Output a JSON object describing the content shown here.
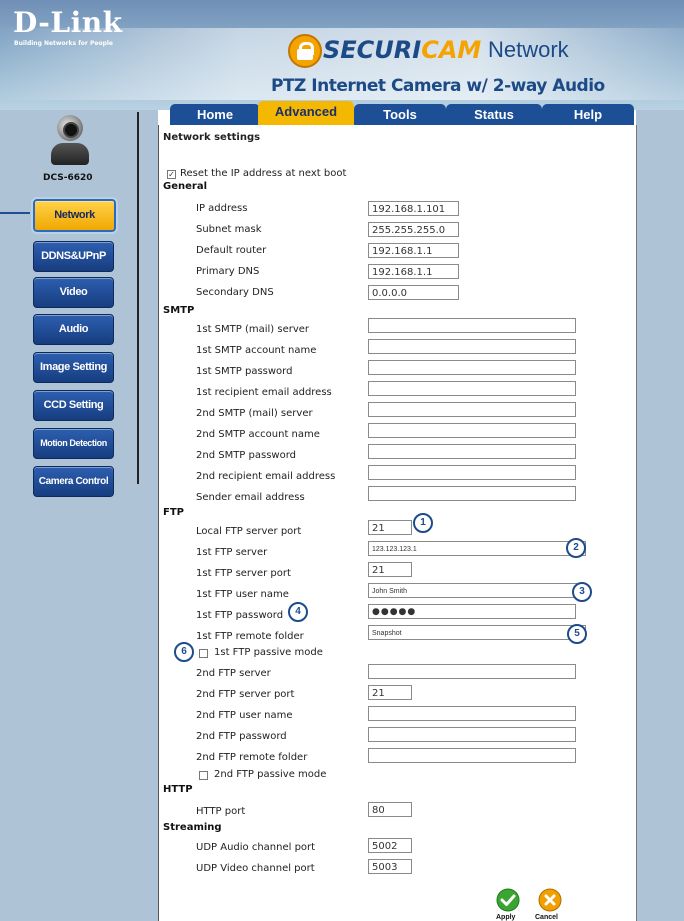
{
  "header": {
    "brand": "D-Link",
    "tagline": "Building Networks for People",
    "product_secu": "SECURI",
    "product_cam": "CAM",
    "product_network": "Network",
    "product_subtitle": "PTZ Internet Camera w/ 2-way Audio"
  },
  "tabs": [
    "Home",
    "Advanced",
    "Tools",
    "Status",
    "Help"
  ],
  "sidebar": {
    "model": "DCS-6620",
    "items": [
      "Network",
      "DDNS&UPnP",
      "Video",
      "Audio",
      "Image Setting",
      "CCD Setting",
      "Motion Detection",
      "Camera Control"
    ]
  },
  "page_title": "Network settings",
  "reset_checkbox_label": "Reset the IP address at next boot",
  "general": {
    "title": "General",
    "labels": [
      "IP address",
      "Subnet mask",
      "Default router",
      "Primary DNS",
      "Secondary DNS"
    ],
    "values": [
      "192.168.1.101",
      "255.255.255.0",
      "192.168.1.1",
      "192.168.1.1",
      "0.0.0.0"
    ]
  },
  "smtp": {
    "title": "SMTP",
    "labels": [
      "1st SMTP (mail) server",
      "1st SMTP account name",
      "1st SMTP password",
      "1st recipient email address",
      "2nd SMTP (mail) server",
      "2nd SMTP account name",
      "2nd SMTP password",
      "2nd recipient email address",
      "Sender email address"
    ]
  },
  "ftp": {
    "title": "FTP",
    "labels": [
      "Local FTP server port",
      "1st FTP server",
      "1st FTP server port",
      "1st FTP user name",
      "1st FTP password",
      "1st FTP remote folder",
      "1st FTP passive mode",
      "2nd FTP server",
      "2nd FTP server port",
      "2nd FTP user name",
      "2nd FTP password",
      "2nd FTP remote folder",
      "2nd FTP passive mode"
    ],
    "local_port": "21",
    "server1": "123.123.123.1",
    "server1_port": "21",
    "user1": "John Smith",
    "password1": "●●●●●",
    "folder1": "Snapshot",
    "server2_port": "21"
  },
  "http": {
    "title": "HTTP",
    "label": "HTTP port",
    "value": "80"
  },
  "streaming": {
    "title": "Streaming",
    "labels": [
      "UDP Audio channel port",
      "UDP Video channel port"
    ],
    "values": [
      "5002",
      "5003"
    ]
  },
  "callouts": [
    "1",
    "2",
    "3",
    "4",
    "5",
    "6"
  ],
  "actions": {
    "apply": "Apply",
    "cancel": "Cancel"
  },
  "colors": {
    "tab_blue": "#1c4f96",
    "active_yellow": "#f5b800",
    "sidebar_bg": "#aec4d6",
    "apply_green": "#3aa530",
    "cancel_orange": "#f0a000"
  }
}
